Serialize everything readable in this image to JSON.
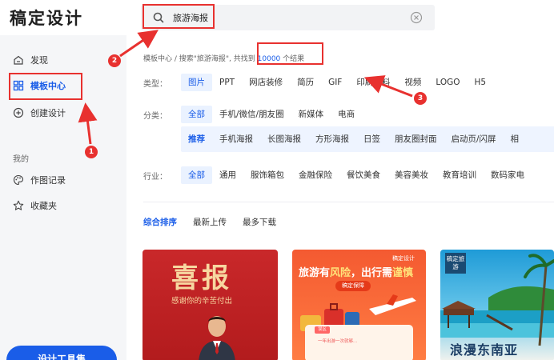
{
  "app": {
    "logo": "稿定设计"
  },
  "search": {
    "value": "旅游海报"
  },
  "sidebar": {
    "items": [
      {
        "label": "发现"
      },
      {
        "label": "模板中心"
      },
      {
        "label": "创建设计"
      }
    ],
    "section_title": "我的",
    "mine_items": [
      {
        "label": "作图记录"
      },
      {
        "label": "收藏夹"
      }
    ],
    "bottom_button": "设计工具集"
  },
  "breadcrumb": {
    "root": "模板中心",
    "sep": " / ",
    "prefix": "搜索\"旅游海报\", 共找到 ",
    "count": "10000",
    "suffix": " 个结果"
  },
  "filters": {
    "type": {
      "label": "类型：",
      "options": [
        "图片",
        "PPT",
        "网店装修",
        "简历",
        "GIF",
        "印刷物料",
        "视频",
        "LOGO",
        "H5"
      ],
      "selected": 0
    },
    "category": {
      "label": "分类：",
      "options": [
        "全部",
        "手机/微信/朋友圈",
        "新媒体",
        "电商"
      ],
      "selected": 0
    },
    "subcategory": {
      "options": [
        "推荐",
        "手机海报",
        "长图海报",
        "方形海报",
        "日签",
        "朋友圈封面",
        "启动页/闪屏",
        "相"
      ],
      "selected": 0
    },
    "industry": {
      "label": "行业：",
      "options": [
        "全部",
        "通用",
        "服饰箱包",
        "金融保险",
        "餐饮美食",
        "美容美妆",
        "教育培训",
        "数码家电"
      ],
      "selected": 0
    }
  },
  "sort": {
    "options": [
      "综合排序",
      "最新上传",
      "最多下载"
    ],
    "selected": 0
  },
  "cards": [
    {
      "title": "喜报",
      "subtitle": "感谢你的辛苦付出"
    },
    {
      "tag": "稿定设计",
      "title_a": "旅游有",
      "title_b": "风险",
      "title_c": "，出行需",
      "title_d": "谨慎",
      "button": "稿定保障",
      "label": "误区",
      "note": "一年出游一次就够..."
    },
    {
      "badge": "稿定旅游",
      "title": "浪漫东南亚"
    }
  ],
  "annotations": [
    "1",
    "2",
    "3"
  ],
  "colors": {
    "accent": "#1a5de8",
    "annotation": "#e8312f",
    "sidebar_bg": "#f5f6f8"
  }
}
